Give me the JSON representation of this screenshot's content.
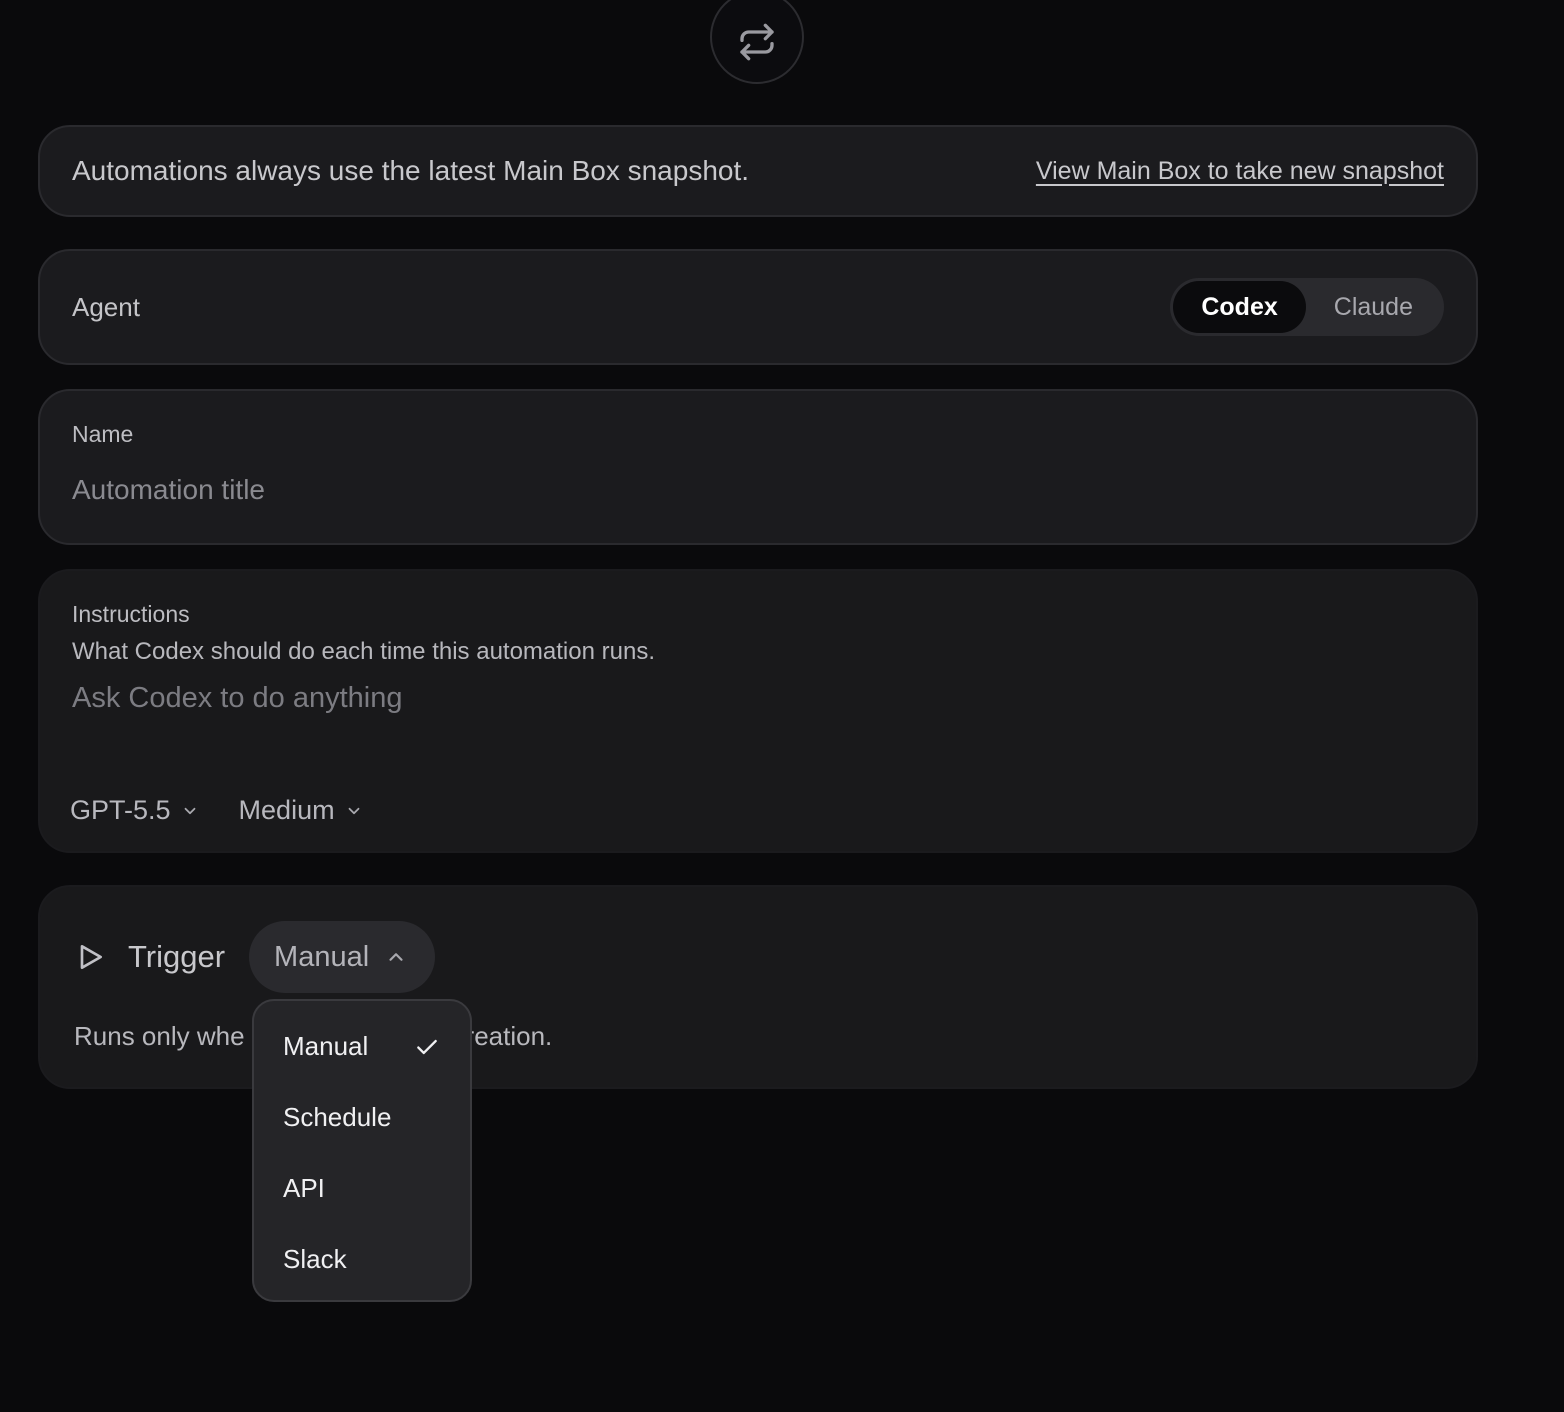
{
  "header": {
    "icon": "repeat-icon"
  },
  "snapshot": {
    "message": "Automations always use the latest Main Box snapshot.",
    "link": "View Main Box to take new snapshot"
  },
  "agent": {
    "label": "Agent",
    "options": [
      "Codex",
      "Claude"
    ],
    "selected": "Codex"
  },
  "name": {
    "label": "Name",
    "placeholder": "Automation title",
    "value": ""
  },
  "instructions": {
    "label": "Instructions",
    "help": "What Codex should do each time this automation runs.",
    "placeholder": "Ask Codex to do anything",
    "value": "",
    "model": "GPT-5.5",
    "effort": "Medium"
  },
  "trigger": {
    "label": "Trigger",
    "selected": "Manual",
    "description_visible": [
      "Runs only whe",
      "reation."
    ]
  },
  "trigger_menu": {
    "items": [
      "Manual",
      "Schedule",
      "API",
      "Slack"
    ],
    "checked": "Manual"
  },
  "colors": {
    "background": "#0a0a0c",
    "card": "#1b1b1e",
    "menu": "#252528",
    "active_segment": "#0b0b0d"
  }
}
